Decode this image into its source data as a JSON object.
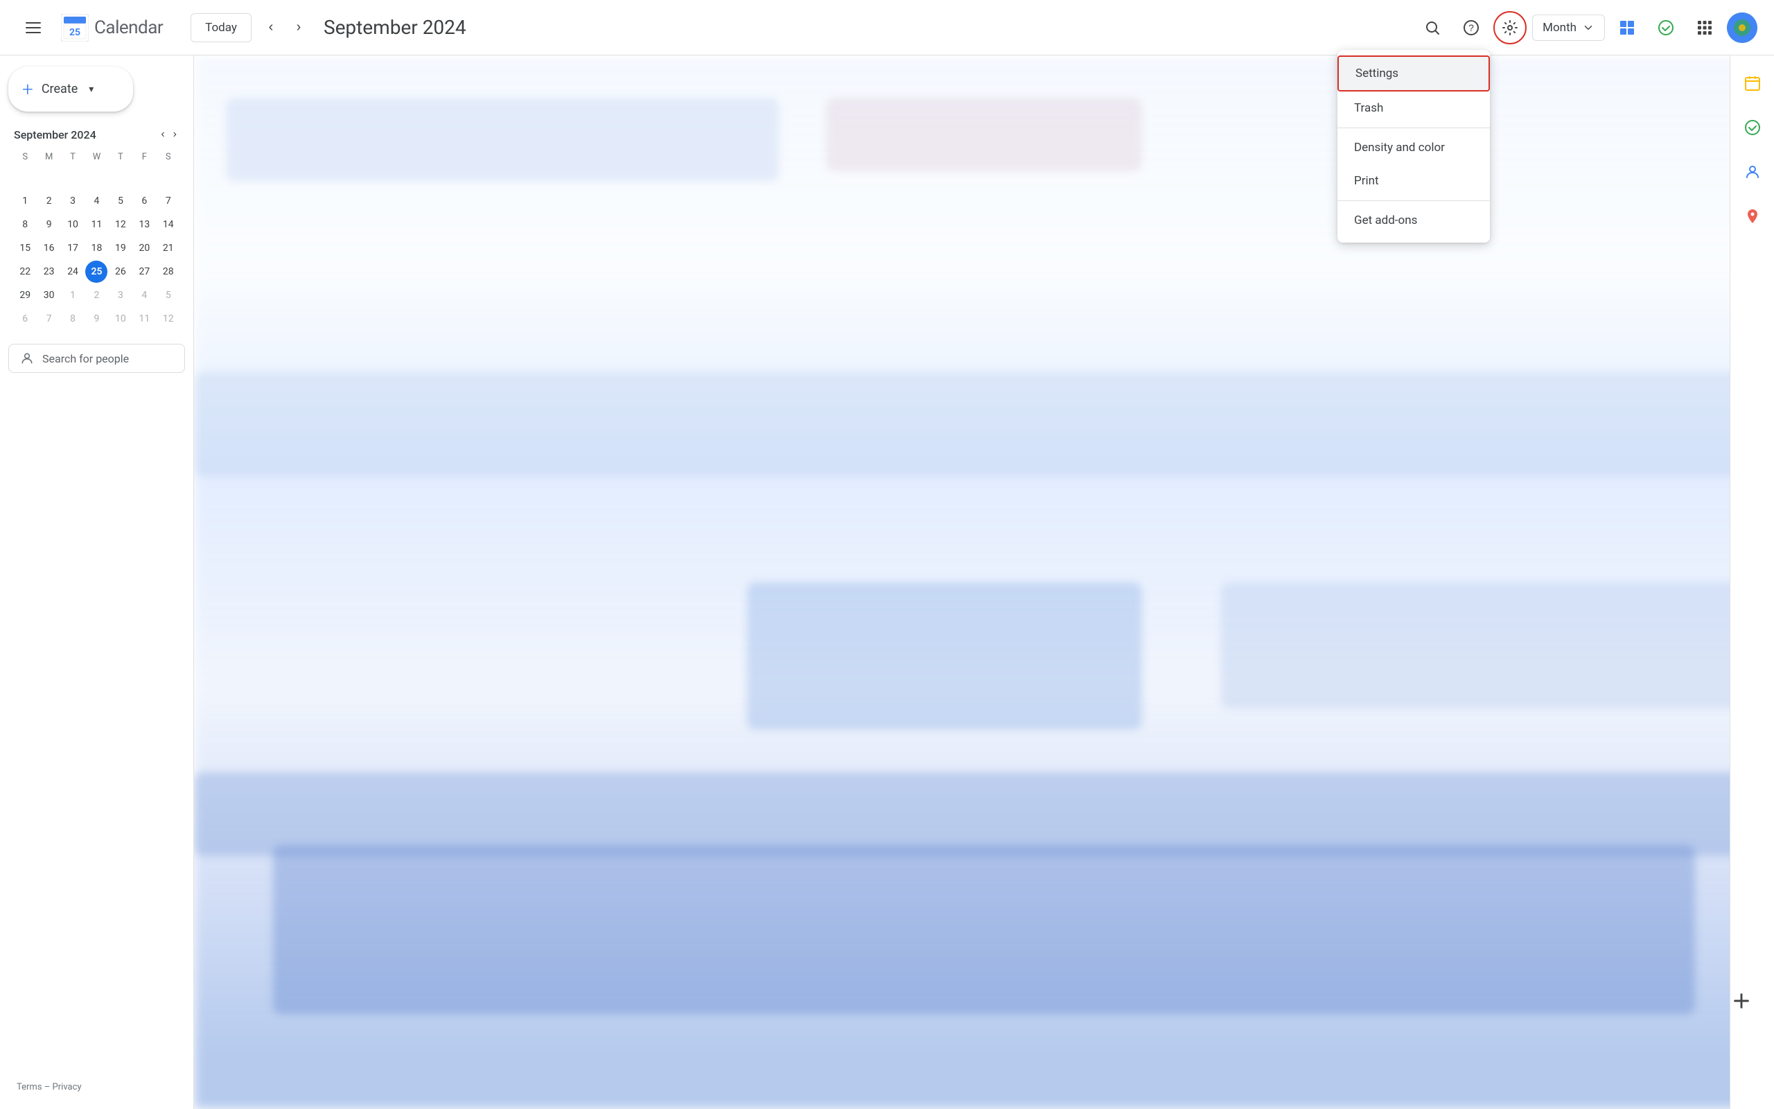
{
  "app": {
    "title": "Calendar",
    "current_date": "September 2024"
  },
  "topbar": {
    "today_label": "Today",
    "month_label": "Month",
    "search_placeholder": "Search"
  },
  "mini_calendar": {
    "month_year": "September 2024",
    "day_headers": [
      "S",
      "M",
      "T",
      "W",
      "T",
      "F",
      "S"
    ],
    "weeks": [
      [
        {
          "day": "",
          "other": true
        },
        {
          "day": "",
          "other": true
        },
        {
          "day": "",
          "other": true
        },
        {
          "day": "",
          "other": true
        },
        {
          "day": "",
          "other": true
        },
        {
          "day": "",
          "other": true
        },
        {
          "day": "",
          "other": true
        }
      ],
      [
        {
          "day": "1"
        },
        {
          "day": "2"
        },
        {
          "day": "3"
        },
        {
          "day": "4"
        },
        {
          "day": "5"
        },
        {
          "day": "6"
        },
        {
          "day": "7"
        }
      ],
      [
        {
          "day": "8"
        },
        {
          "day": "9"
        },
        {
          "day": "10"
        },
        {
          "day": "11"
        },
        {
          "day": "12"
        },
        {
          "day": "13"
        },
        {
          "day": "14"
        }
      ],
      [
        {
          "day": "15"
        },
        {
          "day": "16"
        },
        {
          "day": "17"
        },
        {
          "day": "18"
        },
        {
          "day": "19"
        },
        {
          "day": "20"
        },
        {
          "day": "21"
        }
      ],
      [
        {
          "day": "22"
        },
        {
          "day": "23"
        },
        {
          "day": "24"
        },
        {
          "day": "25",
          "today": true
        },
        {
          "day": "26"
        },
        {
          "day": "27"
        },
        {
          "day": "28"
        }
      ],
      [
        {
          "day": "29"
        },
        {
          "day": "30"
        },
        {
          "day": "1",
          "other": true
        },
        {
          "day": "2",
          "other": true
        },
        {
          "day": "3",
          "other": true
        },
        {
          "day": "4",
          "other": true
        },
        {
          "day": "5",
          "other": true
        }
      ],
      [
        {
          "day": "6",
          "other": true
        },
        {
          "day": "7",
          "other": true
        },
        {
          "day": "8",
          "other": true
        },
        {
          "day": "9",
          "other": true
        },
        {
          "day": "10",
          "other": true
        },
        {
          "day": "11",
          "other": true
        },
        {
          "day": "12",
          "other": true
        }
      ]
    ]
  },
  "search_people": {
    "placeholder": "Search for people"
  },
  "dropdown": {
    "items": [
      {
        "label": "Settings",
        "highlighted": true
      },
      {
        "label": "Trash"
      },
      {
        "label": "Density and color"
      },
      {
        "label": "Print"
      },
      {
        "label": "Get add-ons"
      }
    ]
  },
  "sidebar_bottom": {
    "terms": "Terms",
    "dash": "–",
    "privacy": "Privacy"
  },
  "create_button": {
    "label": "Create"
  }
}
